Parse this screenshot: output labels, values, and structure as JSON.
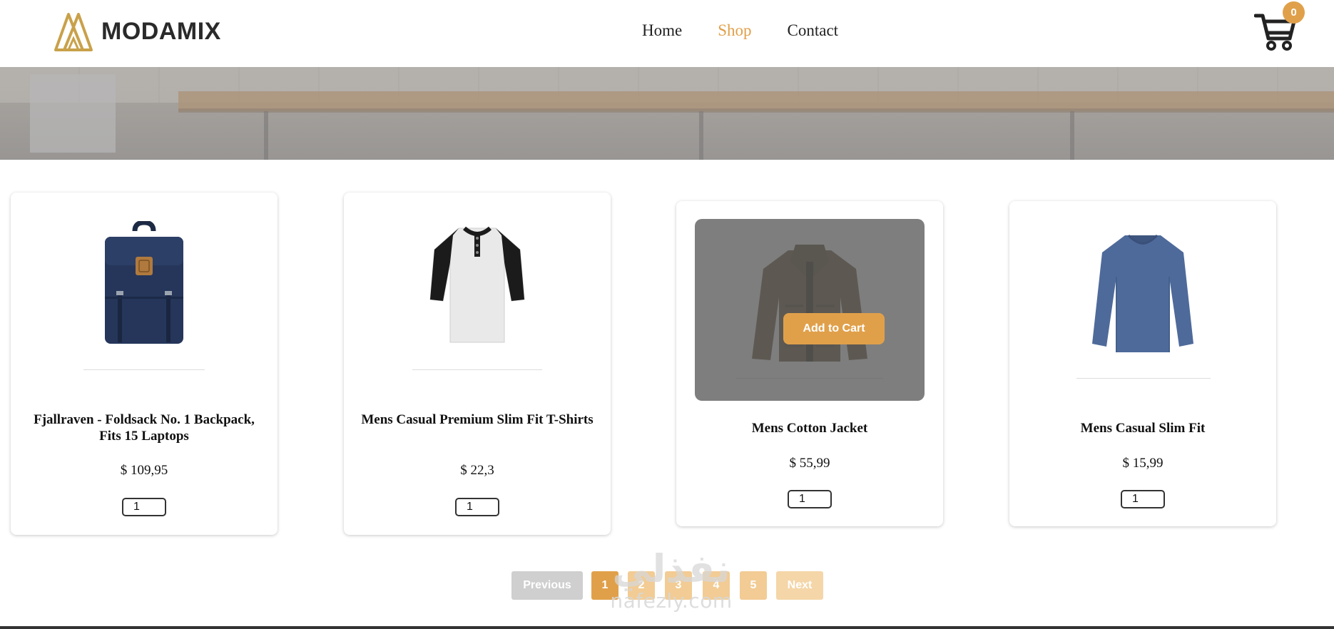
{
  "header": {
    "logo_text": "MODAMIX",
    "nav": [
      {
        "label": "Home",
        "active": false
      },
      {
        "label": "Shop",
        "active": true
      },
      {
        "label": "Contact",
        "active": false
      }
    ],
    "cart_count": "0",
    "accent_color": "#e0a04a"
  },
  "products": [
    {
      "title": "Fjallraven - Foldsack No. 1 Backpack, Fits 15 Laptops",
      "price": "$ 109,95",
      "quantity": "1",
      "icon": "backpack-icon"
    },
    {
      "title": "Mens Casual Premium Slim Fit T-Shirts",
      "price": "$ 22,3",
      "quantity": "1",
      "icon": "tshirt-icon"
    },
    {
      "title": "Mens Cotton Jacket",
      "price": "$ 55,99",
      "quantity": "1",
      "icon": "jacket-icon",
      "hover_action": "Add to Cart"
    },
    {
      "title": "Mens Casual Slim Fit",
      "price": "$ 15,99",
      "quantity": "1",
      "icon": "longsleeve-icon"
    }
  ],
  "pagination": {
    "previous_label": "Previous",
    "pages": [
      "1",
      "2",
      "3",
      "4",
      "5"
    ],
    "active_page": "1",
    "next_label": "Next"
  },
  "watermark": {
    "arabic": "نفذلي",
    "latin": "nafezly.com"
  }
}
